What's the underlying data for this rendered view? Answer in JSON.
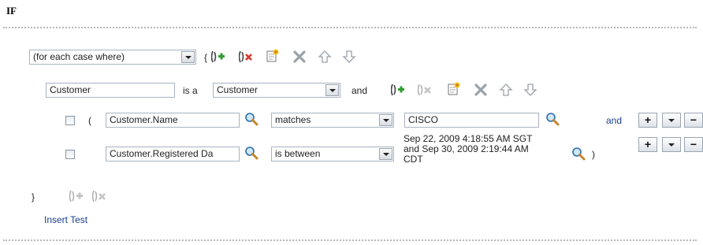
{
  "header": {
    "title": "IF"
  },
  "case_row": {
    "selector_value": "(for each case where)",
    "open_brace": "{",
    "icons": [
      "insert-condition-icon",
      "delete-condition-icon",
      "insert-new-icon",
      "delete-icon",
      "move-up-icon",
      "move-down-icon"
    ]
  },
  "variable_row": {
    "variable_value": "Customer",
    "is_a_label": "is a",
    "type_value": "Customer",
    "and_label": "and",
    "icons": [
      "insert-condition-icon",
      "delete-condition-icon",
      "insert-new-icon",
      "delete-icon",
      "move-up-icon",
      "move-down-icon"
    ]
  },
  "tests": [
    {
      "open_paren": "(",
      "attribute": "Customer.Name",
      "operator": "matches",
      "value": "CISCO",
      "trailing_label": "and",
      "actions": [
        "+",
        "▾",
        "−"
      ]
    },
    {
      "attribute": "Customer.Registered Da",
      "operator": "is between",
      "value_lines": [
        "Sep 22, 2009 4:18:55 AM SGT",
        "and Sep 30, 2009 2:19:44 AM",
        "CDT"
      ],
      "close_paren": ")",
      "actions": [
        "+",
        "▾",
        "−"
      ]
    }
  ],
  "footer": {
    "close_brace": "}",
    "insert_test_label": "Insert Test"
  },
  "colors": {
    "field_border": "#a9b3c0",
    "link": "#1b3f8f",
    "dotted_rule": "#b8b8b8"
  }
}
